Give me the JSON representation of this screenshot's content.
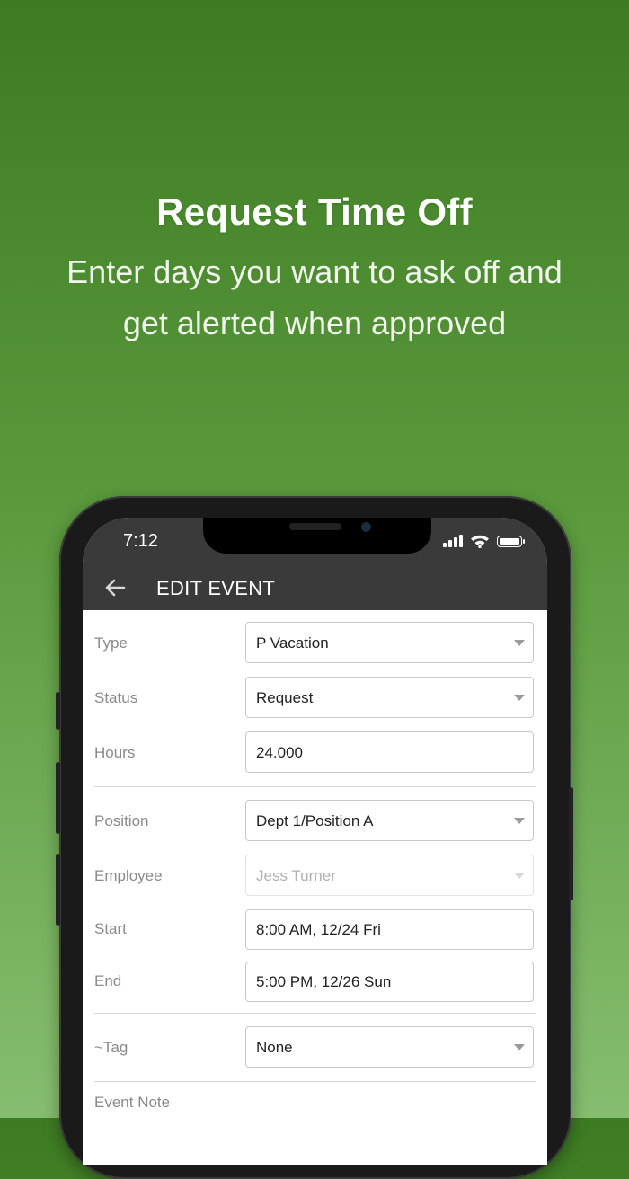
{
  "promo": {
    "headline": "Request Time Off",
    "subline": "Enter days you want to ask off and get alerted when approved"
  },
  "status_bar": {
    "time": "7:12"
  },
  "app_bar": {
    "title": "EDIT EVENT",
    "back_icon": "arrow-left-icon"
  },
  "form": {
    "type": {
      "label": "Type",
      "value": "P Vacation"
    },
    "status": {
      "label": "Status",
      "value": "Request"
    },
    "hours": {
      "label": "Hours",
      "value": "24.000"
    },
    "position": {
      "label": "Position",
      "value": "Dept 1/Position A"
    },
    "employee": {
      "label": "Employee",
      "value": "Jess Turner"
    },
    "start": {
      "label": "Start",
      "value": "8:00 AM, 12/24 Fri"
    },
    "end": {
      "label": "End",
      "value": "5:00 PM, 12/26 Sun"
    },
    "tag": {
      "label": "~Tag",
      "value": "None"
    },
    "note": {
      "label": "Event Note"
    }
  },
  "colors": {
    "background_top": "#3d7b22",
    "background_bottom": "#86bd70",
    "app_bar": "#3a3a3a"
  }
}
